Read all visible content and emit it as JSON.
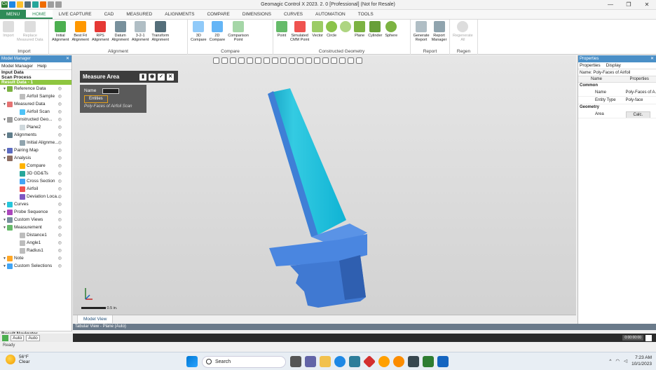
{
  "window": {
    "title": "Geomagic Control X 2023. 2. 0 [Professional] (Not for Resale)"
  },
  "tabs": [
    "MENU",
    "HOME",
    "LIVE CAPTURE",
    "CAD",
    "MEASURED",
    "ALIGNMENTS",
    "COMPARE",
    "DIMENSIONS",
    "CURVES",
    "AUTOMATION",
    "TOOLS"
  ],
  "ribbon": {
    "import": {
      "label": "Import",
      "buttons": [
        "Import",
        "Replace\nMeasured Data"
      ]
    },
    "alignment": {
      "label": "Alignment",
      "buttons": [
        "Initial\nAlignment",
        "Best Fit\nAlignment",
        "RPS\nAlignment",
        "Datum\nAlignment",
        "3-2-1\nAlignment",
        "Transform\nAlignment"
      ]
    },
    "compare": {
      "label": "Compare",
      "buttons": [
        "3D\nCompare",
        "2D\nCompare",
        "Comparison\nPoint"
      ]
    },
    "constructed": {
      "label": "Constructed Geometry",
      "buttons": [
        "Point",
        "Simulated\nCMM Point",
        "Vector",
        "Circle",
        "",
        "Plane",
        "Cylinder",
        "Sphere"
      ]
    },
    "report": {
      "label": "Report",
      "buttons": [
        "Generate\nReport",
        "Report\nManager"
      ]
    },
    "regen": {
      "label": "Regen",
      "buttons": [
        "Regenerate\nAll"
      ]
    }
  },
  "model_manager": {
    "title": "Model Manager",
    "tabs": [
      "Model Manager",
      "Help"
    ],
    "input_data": "Input Data",
    "scan_process": "Scan Process",
    "result_data": "Result Data - 1",
    "tree": [
      {
        "label": "Reference Data",
        "depth": 0,
        "color": "#7cb342"
      },
      {
        "label": "Airfoil Sample",
        "depth": 1,
        "color": "#bdbdbd"
      },
      {
        "label": "Measured Data",
        "depth": 0,
        "color": "#e57373"
      },
      {
        "label": "Airfoil Scan",
        "depth": 1,
        "color": "#4fc3f7"
      },
      {
        "label": "Constructed Geo...",
        "depth": 0,
        "color": "#9e9e9e"
      },
      {
        "label": "Plane2",
        "depth": 1,
        "color": "#cfd8dc"
      },
      {
        "label": "Alignments",
        "depth": 0,
        "color": "#607d8b"
      },
      {
        "label": "Initial Alignme...",
        "depth": 1,
        "color": "#90a4ae"
      },
      {
        "label": "Pairing Map",
        "depth": 0,
        "color": "#5c6bc0"
      },
      {
        "label": "Analysis",
        "depth": 0,
        "color": "#8d6e63"
      },
      {
        "label": "Compare",
        "depth": 1,
        "color": "#ffb300"
      },
      {
        "label": "3D GD&Ts",
        "depth": 1,
        "color": "#26a69a"
      },
      {
        "label": "Cross Section",
        "depth": 1,
        "color": "#42a5f5"
      },
      {
        "label": "Airfoil",
        "depth": 1,
        "color": "#ef5350"
      },
      {
        "label": "Deviation Loca...",
        "depth": 1,
        "color": "#7e57c2"
      },
      {
        "label": "Curves",
        "depth": 0,
        "color": "#26c6da"
      },
      {
        "label": "Probe Sequence",
        "depth": 0,
        "color": "#ab47bc"
      },
      {
        "label": "Custom Views",
        "depth": 0,
        "color": "#78909c"
      },
      {
        "label": "Measurement",
        "depth": 0,
        "color": "#66bb6a"
      },
      {
        "label": "Distance1",
        "depth": 1,
        "color": "#bdbdbd"
      },
      {
        "label": "Angle1",
        "depth": 1,
        "color": "#bdbdbd"
      },
      {
        "label": "Radius1",
        "depth": 1,
        "color": "#bdbdbd"
      },
      {
        "label": "Note",
        "depth": 0,
        "color": "#ffa726"
      },
      {
        "label": "Custom Selections",
        "depth": 0,
        "color": "#42a5f5"
      }
    ],
    "navigator": "Result Navigator"
  },
  "measure_area": {
    "title": "Measure Area",
    "name_label": "Name",
    "entities_label": "Entities",
    "entity_value": "Poly-Faces of Airfoil Scan"
  },
  "viewport": {
    "tab": "Model View",
    "scale": "0.5 in."
  },
  "tabular_view": "Tabular View - Plane (Auto)",
  "properties": {
    "title": "Properties",
    "tabs": [
      "Properties",
      "Display"
    ],
    "name_row": "Name: Poly-Faces of Airfoil",
    "headers": [
      "Name",
      "Properties"
    ],
    "common": "Common",
    "rows": [
      {
        "k": "Name",
        "v": "Poly-Faces of A..."
      },
      {
        "k": "Entity Type",
        "v": "Poly-face"
      }
    ],
    "geometry": "Geometry",
    "area_k": "Area",
    "area_v": "Calc."
  },
  "status": {
    "text": "Ready",
    "auto1": "Auto",
    "auto2": "Auto",
    "time": "0:00:00:00"
  },
  "taskbar": {
    "temp": "56°F",
    "weather": "Clear",
    "search": "Search",
    "clock_time": "7:23 AM",
    "clock_date": "10/1/2023"
  }
}
